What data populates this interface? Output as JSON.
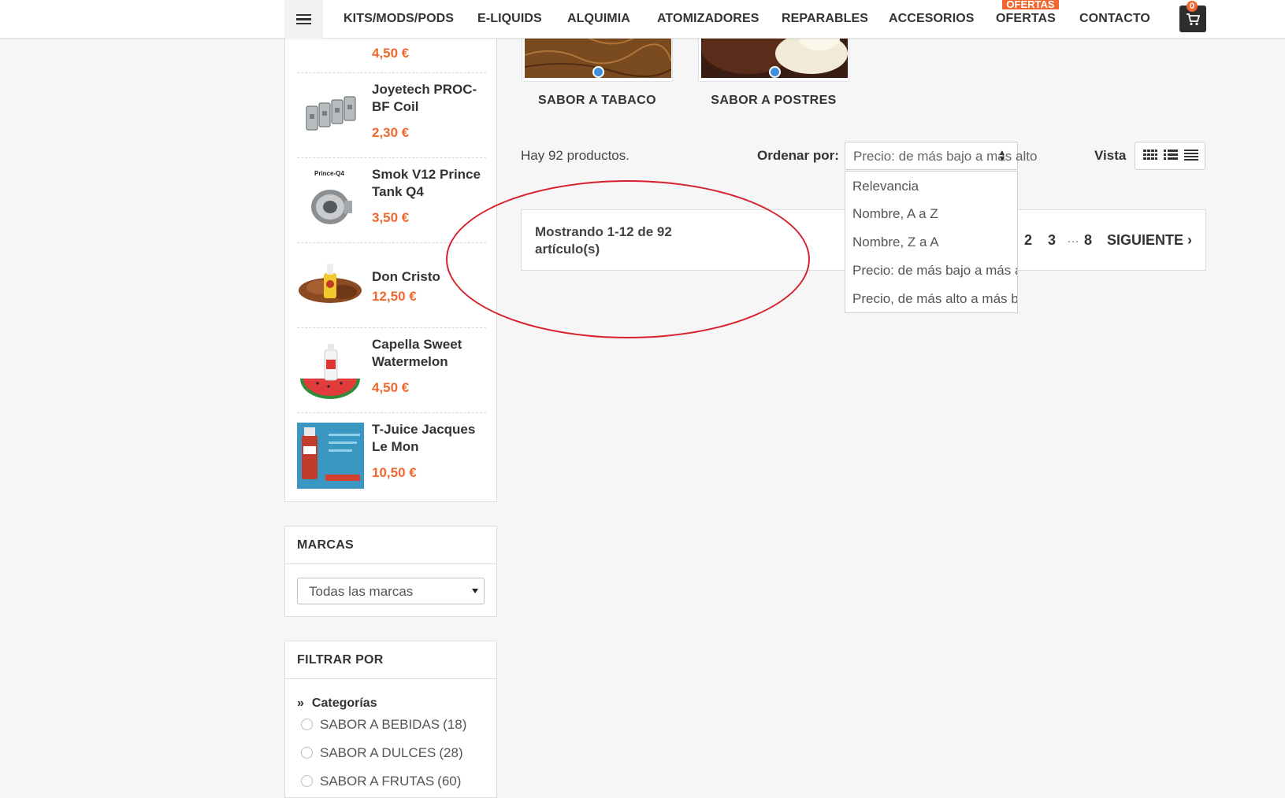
{
  "nav": {
    "items": [
      "KITS/MODS/PODS",
      "E-LIQUIDS",
      "ALQUIMIA",
      "ATOMIZADORES",
      "REPARABLES",
      "ACCESORIOS",
      "OFERTAS",
      "CONTACTO"
    ],
    "ofertas_badge": "OFERTAS",
    "cart_count": "0",
    "menu_icon": "hamburger-icon",
    "cart_icon": "cart-icon"
  },
  "sidebar_products": [
    {
      "name": "",
      "price": "4,50 €"
    },
    {
      "name": "Joyetech PROC-BF Coil",
      "price": "2,30 €"
    },
    {
      "name": "Smok V12 Prince Tank Q4",
      "price": "3,50 €",
      "thumb_label": "Prince-Q4"
    },
    {
      "name": "Don Cristo",
      "price": "12,50 €"
    },
    {
      "name": "Capella Sweet Watermelon",
      "price": "4,50 €"
    },
    {
      "name": "T-Juice Jacques Le Mon",
      "price": "10,50 €"
    }
  ],
  "brands": {
    "title": "MARCAS",
    "selected": "Todas las marcas"
  },
  "filter": {
    "title": "FILTRAR POR",
    "section": "Categorías",
    "options": [
      {
        "label": "SABOR A BEBIDAS",
        "count": "(18)"
      },
      {
        "label": "SABOR A DULCES",
        "count": "(28)"
      },
      {
        "label": "SABOR A FRUTAS",
        "count": "(60)"
      }
    ]
  },
  "categories": [
    {
      "label": "SABOR A TABACO"
    },
    {
      "label": "SABOR A POSTRES"
    }
  ],
  "listing": {
    "count_text": "Hay 92 productos.",
    "sort_label": "Ordenar por:",
    "sort_selected": "Precio: de más bajo a más alto",
    "view_label": "Vista",
    "sort_options": [
      "Relevancia",
      "Nombre, A a Z",
      "Nombre, Z a A",
      "Precio: de más bajo a más alto",
      "Precio, de más alto a más bajo"
    ]
  },
  "pagination": {
    "showing": "Mostrando 1-12 de 92 artículo(s)",
    "pages": [
      "2",
      "3",
      "8"
    ],
    "ellipsis": "…",
    "next": "SIGUIENTE ›"
  },
  "colors": {
    "accent": "#f0682f",
    "annotation": "#d8202a"
  }
}
